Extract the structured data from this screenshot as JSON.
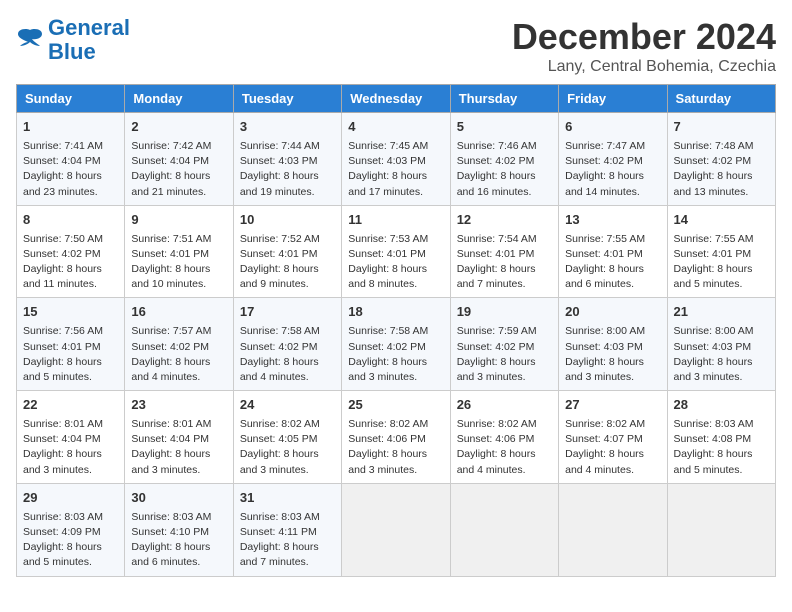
{
  "header": {
    "logo_line1": "General",
    "logo_line2": "Blue",
    "month": "December 2024",
    "location": "Lany, Central Bohemia, Czechia"
  },
  "weekdays": [
    "Sunday",
    "Monday",
    "Tuesday",
    "Wednesday",
    "Thursday",
    "Friday",
    "Saturday"
  ],
  "weeks": [
    [
      {
        "day": "1",
        "lines": [
          "Sunrise: 7:41 AM",
          "Sunset: 4:04 PM",
          "Daylight: 8 hours",
          "and 23 minutes."
        ]
      },
      {
        "day": "2",
        "lines": [
          "Sunrise: 7:42 AM",
          "Sunset: 4:04 PM",
          "Daylight: 8 hours",
          "and 21 minutes."
        ]
      },
      {
        "day": "3",
        "lines": [
          "Sunrise: 7:44 AM",
          "Sunset: 4:03 PM",
          "Daylight: 8 hours",
          "and 19 minutes."
        ]
      },
      {
        "day": "4",
        "lines": [
          "Sunrise: 7:45 AM",
          "Sunset: 4:03 PM",
          "Daylight: 8 hours",
          "and 17 minutes."
        ]
      },
      {
        "day": "5",
        "lines": [
          "Sunrise: 7:46 AM",
          "Sunset: 4:02 PM",
          "Daylight: 8 hours",
          "and 16 minutes."
        ]
      },
      {
        "day": "6",
        "lines": [
          "Sunrise: 7:47 AM",
          "Sunset: 4:02 PM",
          "Daylight: 8 hours",
          "and 14 minutes."
        ]
      },
      {
        "day": "7",
        "lines": [
          "Sunrise: 7:48 AM",
          "Sunset: 4:02 PM",
          "Daylight: 8 hours",
          "and 13 minutes."
        ]
      }
    ],
    [
      {
        "day": "8",
        "lines": [
          "Sunrise: 7:50 AM",
          "Sunset: 4:02 PM",
          "Daylight: 8 hours",
          "and 11 minutes."
        ]
      },
      {
        "day": "9",
        "lines": [
          "Sunrise: 7:51 AM",
          "Sunset: 4:01 PM",
          "Daylight: 8 hours",
          "and 10 minutes."
        ]
      },
      {
        "day": "10",
        "lines": [
          "Sunrise: 7:52 AM",
          "Sunset: 4:01 PM",
          "Daylight: 8 hours",
          "and 9 minutes."
        ]
      },
      {
        "day": "11",
        "lines": [
          "Sunrise: 7:53 AM",
          "Sunset: 4:01 PM",
          "Daylight: 8 hours",
          "and 8 minutes."
        ]
      },
      {
        "day": "12",
        "lines": [
          "Sunrise: 7:54 AM",
          "Sunset: 4:01 PM",
          "Daylight: 8 hours",
          "and 7 minutes."
        ]
      },
      {
        "day": "13",
        "lines": [
          "Sunrise: 7:55 AM",
          "Sunset: 4:01 PM",
          "Daylight: 8 hours",
          "and 6 minutes."
        ]
      },
      {
        "day": "14",
        "lines": [
          "Sunrise: 7:55 AM",
          "Sunset: 4:01 PM",
          "Daylight: 8 hours",
          "and 5 minutes."
        ]
      }
    ],
    [
      {
        "day": "15",
        "lines": [
          "Sunrise: 7:56 AM",
          "Sunset: 4:01 PM",
          "Daylight: 8 hours",
          "and 5 minutes."
        ]
      },
      {
        "day": "16",
        "lines": [
          "Sunrise: 7:57 AM",
          "Sunset: 4:02 PM",
          "Daylight: 8 hours",
          "and 4 minutes."
        ]
      },
      {
        "day": "17",
        "lines": [
          "Sunrise: 7:58 AM",
          "Sunset: 4:02 PM",
          "Daylight: 8 hours",
          "and 4 minutes."
        ]
      },
      {
        "day": "18",
        "lines": [
          "Sunrise: 7:58 AM",
          "Sunset: 4:02 PM",
          "Daylight: 8 hours",
          "and 3 minutes."
        ]
      },
      {
        "day": "19",
        "lines": [
          "Sunrise: 7:59 AM",
          "Sunset: 4:02 PM",
          "Daylight: 8 hours",
          "and 3 minutes."
        ]
      },
      {
        "day": "20",
        "lines": [
          "Sunrise: 8:00 AM",
          "Sunset: 4:03 PM",
          "Daylight: 8 hours",
          "and 3 minutes."
        ]
      },
      {
        "day": "21",
        "lines": [
          "Sunrise: 8:00 AM",
          "Sunset: 4:03 PM",
          "Daylight: 8 hours",
          "and 3 minutes."
        ]
      }
    ],
    [
      {
        "day": "22",
        "lines": [
          "Sunrise: 8:01 AM",
          "Sunset: 4:04 PM",
          "Daylight: 8 hours",
          "and 3 minutes."
        ]
      },
      {
        "day": "23",
        "lines": [
          "Sunrise: 8:01 AM",
          "Sunset: 4:04 PM",
          "Daylight: 8 hours",
          "and 3 minutes."
        ]
      },
      {
        "day": "24",
        "lines": [
          "Sunrise: 8:02 AM",
          "Sunset: 4:05 PM",
          "Daylight: 8 hours",
          "and 3 minutes."
        ]
      },
      {
        "day": "25",
        "lines": [
          "Sunrise: 8:02 AM",
          "Sunset: 4:06 PM",
          "Daylight: 8 hours",
          "and 3 minutes."
        ]
      },
      {
        "day": "26",
        "lines": [
          "Sunrise: 8:02 AM",
          "Sunset: 4:06 PM",
          "Daylight: 8 hours",
          "and 4 minutes."
        ]
      },
      {
        "day": "27",
        "lines": [
          "Sunrise: 8:02 AM",
          "Sunset: 4:07 PM",
          "Daylight: 8 hours",
          "and 4 minutes."
        ]
      },
      {
        "day": "28",
        "lines": [
          "Sunrise: 8:03 AM",
          "Sunset: 4:08 PM",
          "Daylight: 8 hours",
          "and 5 minutes."
        ]
      }
    ],
    [
      {
        "day": "29",
        "lines": [
          "Sunrise: 8:03 AM",
          "Sunset: 4:09 PM",
          "Daylight: 8 hours",
          "and 5 minutes."
        ]
      },
      {
        "day": "30",
        "lines": [
          "Sunrise: 8:03 AM",
          "Sunset: 4:10 PM",
          "Daylight: 8 hours",
          "and 6 minutes."
        ]
      },
      {
        "day": "31",
        "lines": [
          "Sunrise: 8:03 AM",
          "Sunset: 4:11 PM",
          "Daylight: 8 hours",
          "and 7 minutes."
        ]
      },
      null,
      null,
      null,
      null
    ]
  ]
}
